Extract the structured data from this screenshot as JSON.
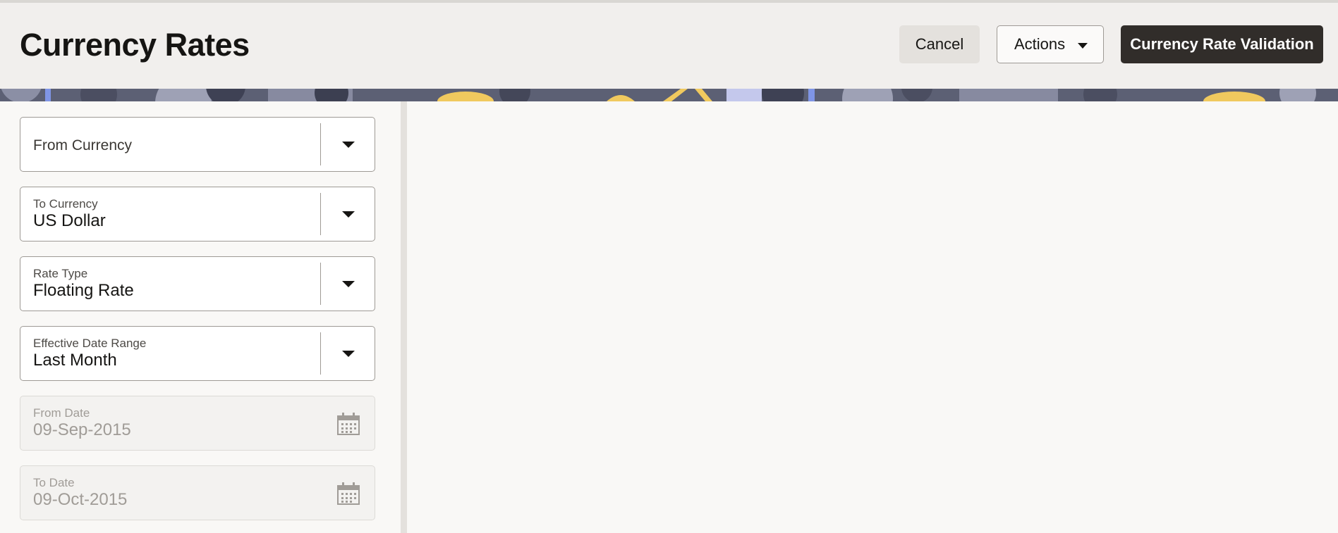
{
  "header": {
    "title": "Currency Rates",
    "cancel_label": "Cancel",
    "actions_label": "Actions",
    "validate_label": "Currency Rate Validation"
  },
  "filters": {
    "from_currency": {
      "placeholder": "From Currency"
    },
    "to_currency": {
      "label": "To Currency",
      "value": "US Dollar"
    },
    "rate_type": {
      "label": "Rate Type",
      "value": "Floating Rate"
    },
    "date_range": {
      "label": "Effective Date Range",
      "value": "Last Month"
    },
    "from_date": {
      "label": "From Date",
      "value": "09-Sep-2015"
    },
    "to_date": {
      "label": "To Date",
      "value": "09-Oct-2015"
    }
  },
  "icons": {
    "dropdown": "chevron-down-icon",
    "calendar": "calendar-icon"
  },
  "colors": {
    "primary_button": "#312d2a",
    "header_bg": "#f1efed",
    "banner_accent": "#f0c95e",
    "banner_base": "#6c7184"
  }
}
